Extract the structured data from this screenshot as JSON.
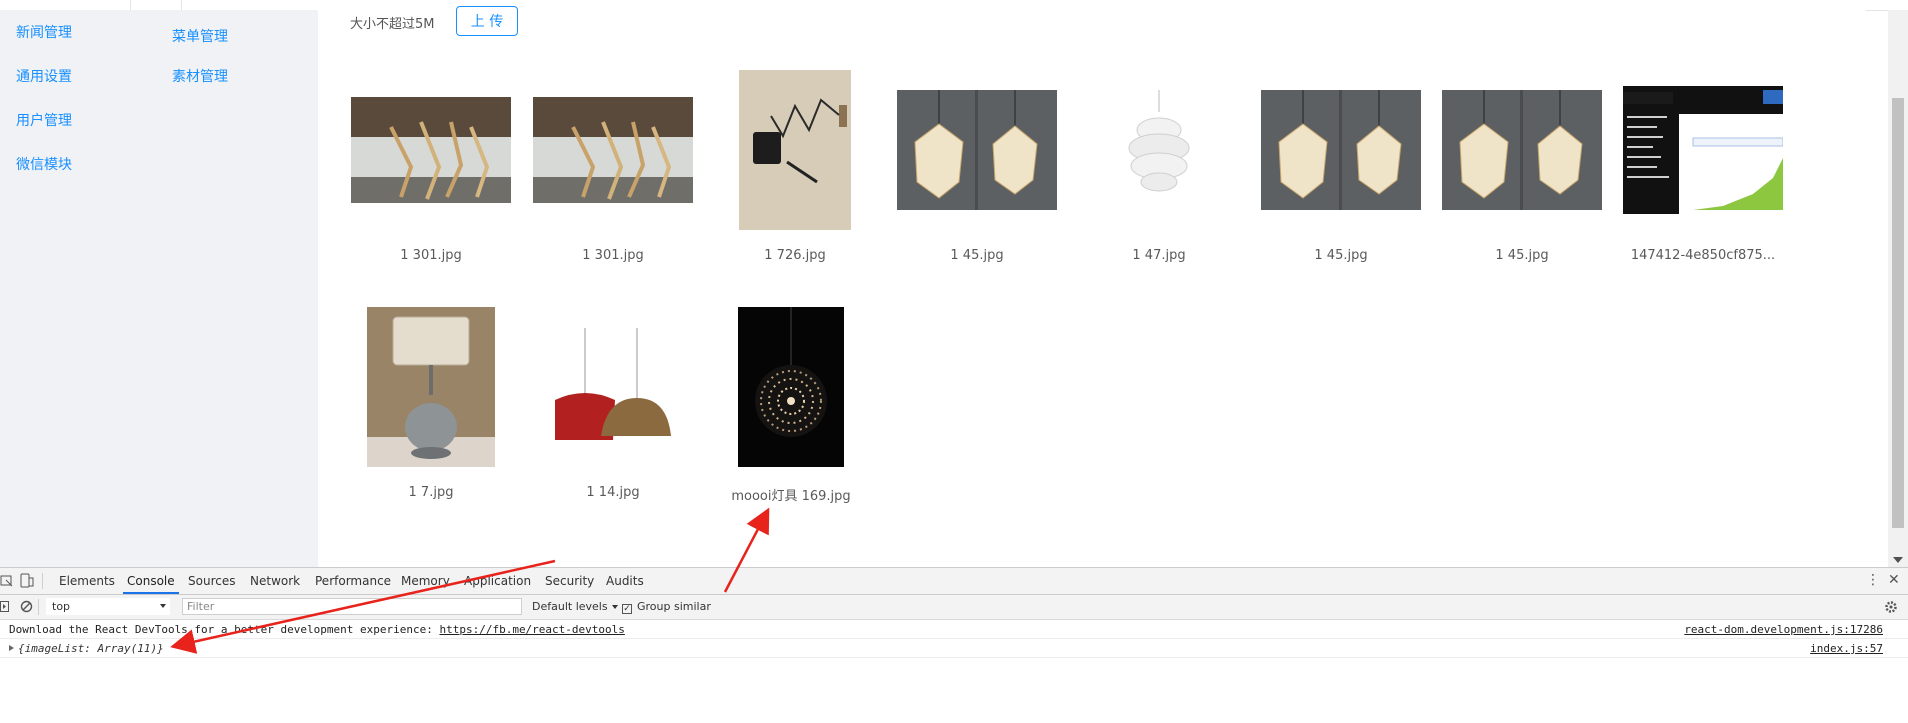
{
  "sidebar": {
    "col1": [
      "新闻管理",
      "通用设置",
      "用户管理",
      "微信模块"
    ],
    "col2": [
      "菜单管理",
      "素材管理"
    ]
  },
  "upload": {
    "hint": "大小不超过5M",
    "button_label": "上 传"
  },
  "images": [
    {
      "name": "1 301.jpg",
      "icon": "wooden-sculpture-photo"
    },
    {
      "name": "1 301.jpg",
      "icon": "wooden-sculpture-photo"
    },
    {
      "name": "1 726.jpg",
      "icon": "wall-lamp-photo"
    },
    {
      "name": "1 45.jpg",
      "icon": "geometric-pendant-photo"
    },
    {
      "name": "1 47.jpg",
      "icon": "white-swirl-lamp-photo"
    },
    {
      "name": "1 45.jpg",
      "icon": "geometric-pendant-photo"
    },
    {
      "name": "1 45.jpg",
      "icon": "geometric-pendant-photo"
    },
    {
      "name": "147412-4e850cf875...",
      "icon": "screenshot-chart-photo"
    },
    {
      "name": "1 7.jpg",
      "icon": "table-lamp-photo"
    },
    {
      "name": "1 14.jpg",
      "icon": "pendant-bowls-photo"
    },
    {
      "name": "moooi灯具 169.jpg",
      "icon": "sparkle-ball-lamp-photo"
    }
  ],
  "devtools": {
    "tabs": [
      "Elements",
      "Console",
      "Sources",
      "Network",
      "Performance",
      "Memory",
      "Application",
      "Security",
      "Audits"
    ],
    "active_tab": "Console",
    "context": "top",
    "filter_placeholder": "Filter",
    "levels": "Default levels",
    "group_similar": "Group similar",
    "group_similar_checked": true,
    "messages": [
      {
        "prefix": "Download the React DevTools for a better development experience: ",
        "link": "https://fb.me/react-devtools",
        "source": "react-dom.development.js:17286"
      },
      {
        "object": "{imageList: Array(11)}",
        "source": "index.js:57"
      }
    ]
  },
  "colors": {
    "accent": "#1890ff",
    "sidebar_bg": "#f0f2f5",
    "annotation": "#e8231c"
  }
}
